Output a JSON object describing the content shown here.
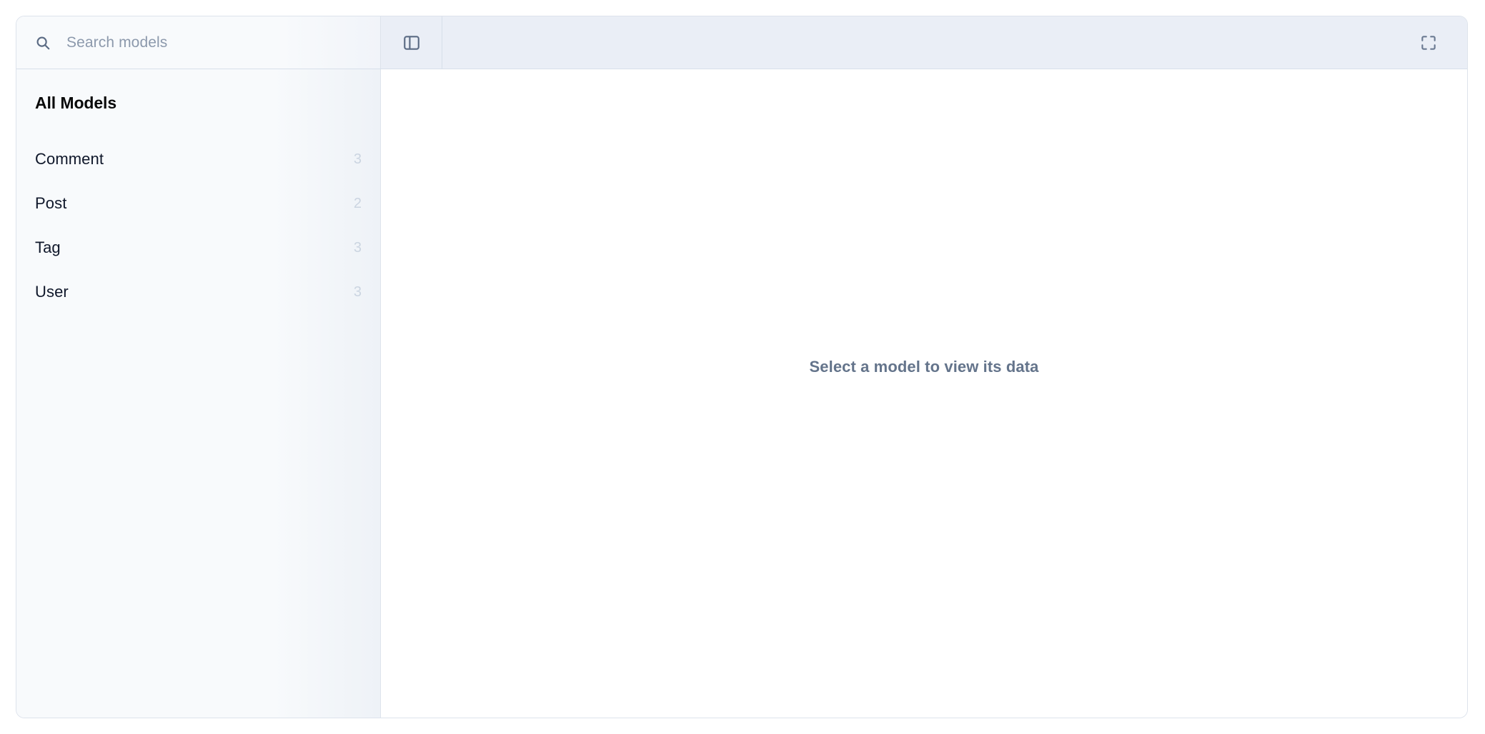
{
  "search": {
    "placeholder": "Search models",
    "value": "",
    "icon": "search-icon"
  },
  "header": {
    "sidebar_toggle_icon": "panel-left-icon",
    "fullscreen_icon": "fullscreen-icon",
    "title": ""
  },
  "sidebar": {
    "heading": "All Models",
    "items": [
      {
        "label": "Comment",
        "count": "3"
      },
      {
        "label": "Post",
        "count": "2"
      },
      {
        "label": "Tag",
        "count": "3"
      },
      {
        "label": "User",
        "count": "3"
      }
    ]
  },
  "main": {
    "empty_state_message": "Select a model to view its data"
  },
  "colors": {
    "page_background": "#ffffff",
    "sidebar_background": "#f8fafc",
    "header_strip": "#eaeef6",
    "border": "#dde3ec",
    "text_primary": "#0f172a",
    "text_muted": "#64748b",
    "count_text": "#cbd5e1",
    "placeholder_text": "#8c99ac",
    "icon_stroke": "#64748b"
  }
}
